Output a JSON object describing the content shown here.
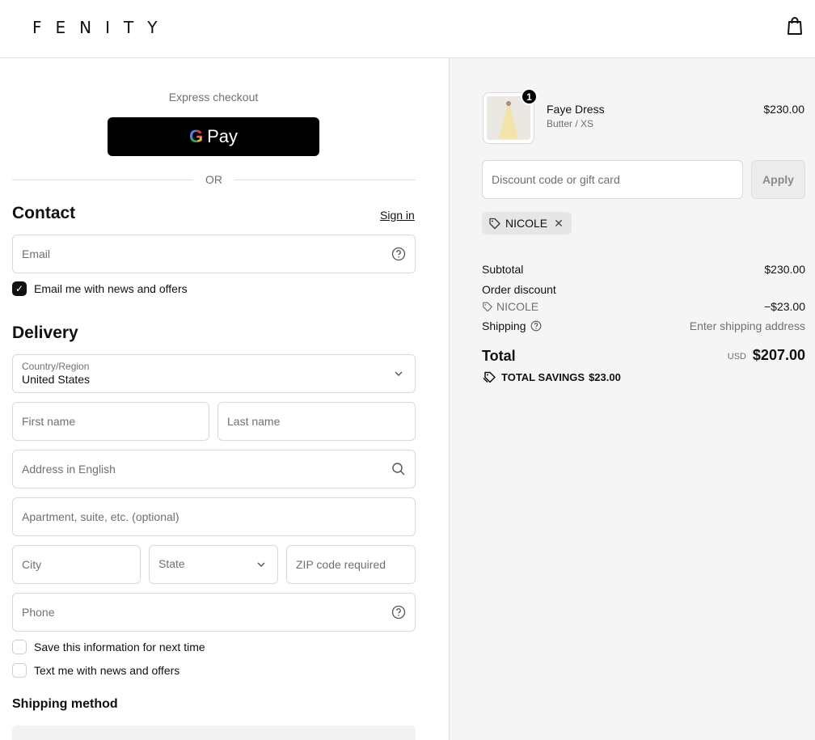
{
  "header": {
    "logo": "FENITY",
    "cart_icon": "shopping-bag-icon"
  },
  "express": {
    "title": "Express checkout",
    "gpay_label": "Pay",
    "or_label": "OR"
  },
  "contact": {
    "title": "Contact",
    "sign_in": "Sign in",
    "email_placeholder": "Email",
    "news_label": "Email me with news and offers",
    "news_checked": true
  },
  "delivery": {
    "title": "Delivery",
    "country_label": "Country/Region",
    "country_value": "United States",
    "first_name_placeholder": "First name",
    "last_name_placeholder": "Last name",
    "address_placeholder": "Address in English",
    "apartment_placeholder": "Apartment, suite, etc. (optional)",
    "city_placeholder": "City",
    "state_placeholder": "State",
    "zip_placeholder": "ZIP code required",
    "phone_placeholder": "Phone",
    "save_info_label": "Save this information for next time",
    "text_news_label": "Text me with news and offers"
  },
  "shipping_method": {
    "title": "Shipping method"
  },
  "order": {
    "item": {
      "name": "Faye Dress",
      "variant": "Butter / XS",
      "price": "$230.00",
      "quantity": "1"
    },
    "discount_placeholder": "Discount code or gift card",
    "apply_label": "Apply",
    "applied_code": "NICOLE",
    "subtotal_label": "Subtotal",
    "subtotal_value": "$230.00",
    "order_discount_label": "Order discount",
    "discount_code": "NICOLE",
    "discount_value": "−$23.00",
    "shipping_label": "Shipping",
    "shipping_value": "Enter shipping address",
    "total_label": "Total",
    "currency": "USD",
    "total_value": "$207.00",
    "savings_label": "TOTAL SAVINGS",
    "savings_value": "$23.00"
  }
}
